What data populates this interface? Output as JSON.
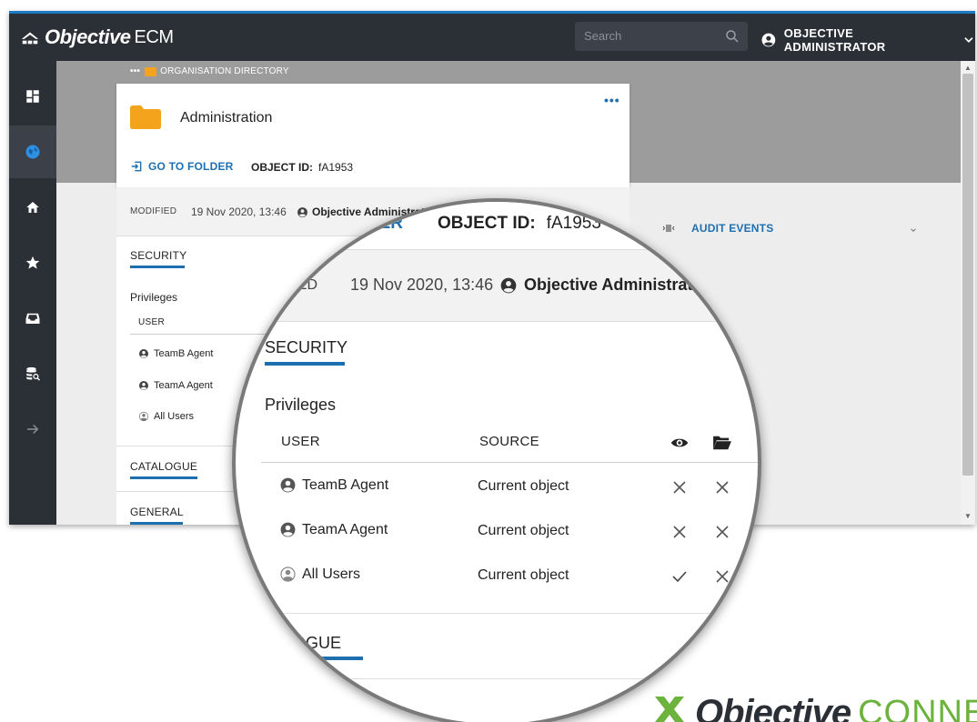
{
  "app": {
    "brand_bold": "Objective",
    "brand_light": "ECM",
    "search_placeholder": "Search",
    "user_name": "OBJECTIVE ADMINISTRATOR"
  },
  "breadcrumb": {
    "ellipsis": "•••",
    "label": "ORGANISATION DIRECTORY"
  },
  "folder": {
    "title": "Administration",
    "more": "•••",
    "goto_label": "GO TO FOLDER",
    "object_id_label": "OBJECT ID:",
    "object_id_value": "fA1953"
  },
  "modified": {
    "label": "MODIFIED",
    "date": "19 Nov 2020, 13:46",
    "by": "Objective Administrator"
  },
  "sections": {
    "security": "SECURITY",
    "privileges": "Privileges",
    "catalogue": "CATALOGUE",
    "general": "GENERAL"
  },
  "privileges_table": {
    "columns": [
      "USER",
      "SOURCE"
    ],
    "rows": [
      {
        "user": "TeamB Agent",
        "source": "Current object",
        "view": false,
        "folder": false
      },
      {
        "user": "TeamA Agent",
        "source": "Current object",
        "view": false,
        "folder": false
      },
      {
        "user": "All Users",
        "source": "Current object",
        "view": true,
        "folder": false
      }
    ]
  },
  "audit": {
    "label": "AUDIT EVENTS"
  },
  "footer_logo": {
    "bold": "Objective",
    "light": "CONNECT"
  },
  "colors": {
    "accent_blue": "#1e6fb0",
    "folder_orange": "#f4a31c",
    "dark_bar": "#2b2f36",
    "connect_green": "#6cb33e"
  },
  "icons": {
    "rail": [
      "dashboard-icon",
      "globe-icon",
      "home-icon",
      "star-icon",
      "inbox-icon",
      "database-search-icon",
      "arrow-right-icon"
    ]
  }
}
